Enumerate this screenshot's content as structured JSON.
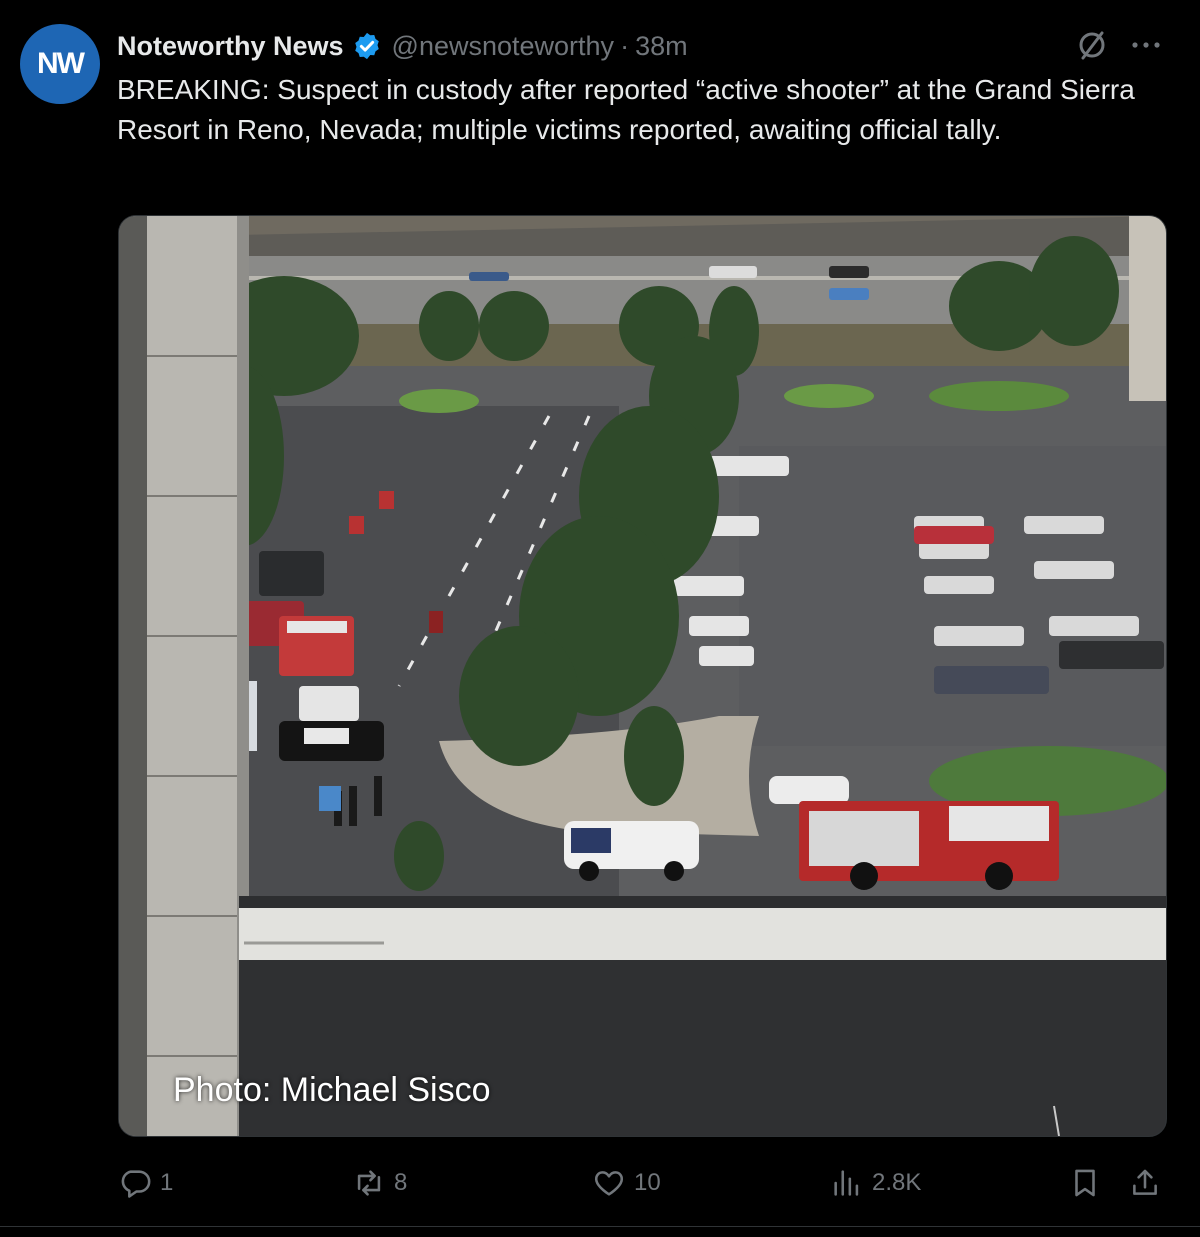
{
  "author": {
    "avatar_initials": "NW",
    "name": "Noteworthy News",
    "handle": "@newsnoteworthy",
    "separator": "·",
    "time": "38m"
  },
  "post": {
    "text": "BREAKING: Suspect in custody after reported “active shooter” at the Grand Sierra Resort in Reno, Nevada; multiple victims reported, awaiting official tally.",
    "photo_caption": "Photo: Michael Sisco"
  },
  "actions": {
    "replies": "1",
    "reposts": "8",
    "likes": "10",
    "views": "2.8K"
  },
  "colors": {
    "background": "#000000",
    "text": "#e7e9ea",
    "muted": "#71767b",
    "verified": "#1d9bf0",
    "avatar": "#1e66b4"
  },
  "icons": [
    "verified-badge-icon",
    "grok-icon",
    "more-icon",
    "reply-icon",
    "repost-icon",
    "like-icon",
    "views-icon",
    "bookmark-icon",
    "share-icon"
  ]
}
